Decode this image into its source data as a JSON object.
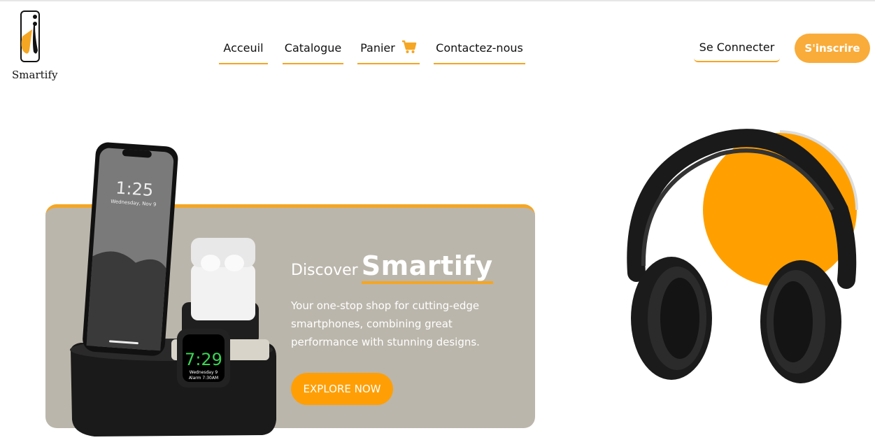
{
  "brand": {
    "name": "Smartify"
  },
  "nav": {
    "items": [
      {
        "label": "Acceuil"
      },
      {
        "label": "Catalogue"
      },
      {
        "label": "Panier"
      },
      {
        "label": "Contactez-nous"
      }
    ]
  },
  "auth": {
    "login_label": "Se Connecter",
    "signup_label": "S'inscrire"
  },
  "hero": {
    "discover": "Discover",
    "brand": "Smartify",
    "description": "Your one-stop shop for cutting-edge smartphones, combining great performance with stunning designs.",
    "cta": "EXPLORE NOW",
    "phone_time": "1:25",
    "phone_date": "Wednesday, Nov 9",
    "watch_time": "7:29",
    "watch_date": "Wednesday 9",
    "watch_alarm": "Alarm 7:30AM"
  },
  "colors": {
    "accent": "#f5a623",
    "cta": "#ff9f05",
    "card": "#bbb6ab"
  },
  "icons": {
    "cart": "cart-icon",
    "logo": "smartify-logo-icon"
  }
}
